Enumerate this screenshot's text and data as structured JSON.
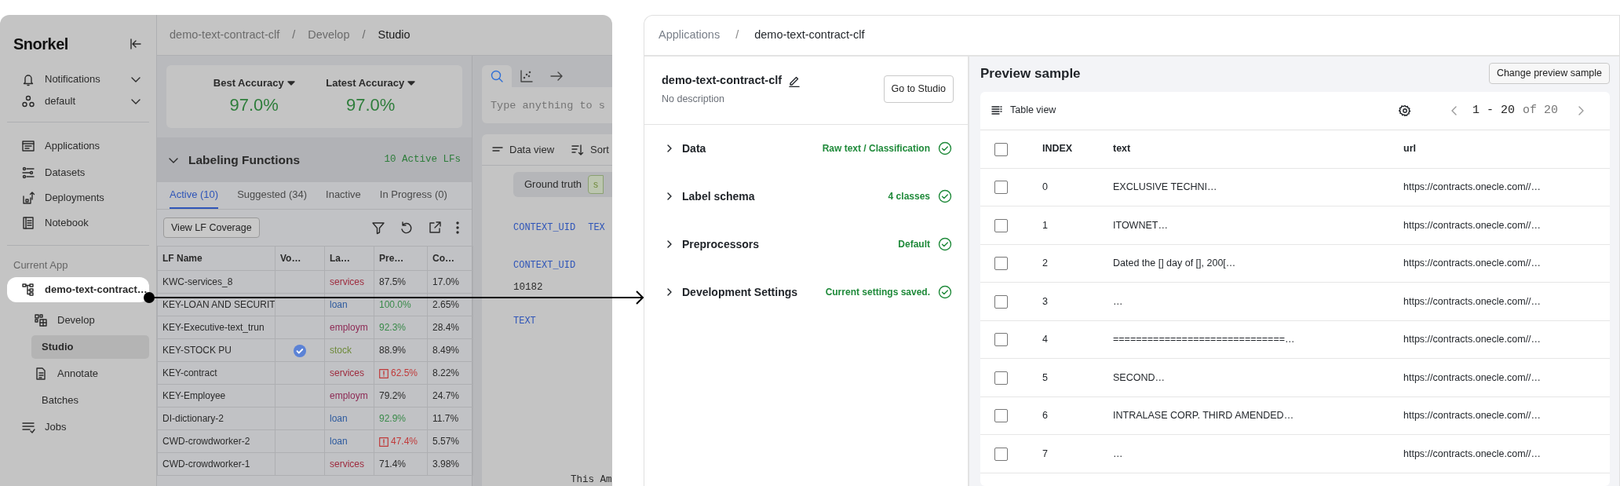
{
  "left_screen": {
    "sidebar": {
      "logo": "Snorkel",
      "menus": [
        {
          "label": "Notifications"
        },
        {
          "label": "default"
        }
      ],
      "nav": [
        {
          "label": "Applications"
        },
        {
          "label": "Datasets"
        },
        {
          "label": "Deployments"
        },
        {
          "label": "Notebook"
        }
      ],
      "section_label": "Current App",
      "tree": [
        {
          "label": "demo-text-contract…",
          "selected": true,
          "children": [
            {
              "label": "Develop",
              "selected": false,
              "children": [
                {
                  "label": "Studio",
                  "selected": true
                }
              ]
            },
            {
              "label": "Annotate",
              "selected": false,
              "children": [
                {
                  "label": "Batches",
                  "selected": false
                }
              ]
            }
          ]
        }
      ],
      "footer_nav": [
        {
          "label": "Jobs"
        }
      ]
    },
    "breadcrumb": {
      "separator": "/",
      "items": [
        "demo-text-contract-clf",
        "Develop",
        "Studio"
      ]
    },
    "accuracy": [
      {
        "label": "Best Accuracy",
        "value": "97.0%"
      },
      {
        "label": "Latest Accuracy",
        "value": "97.0%"
      }
    ],
    "lf_panel": {
      "title": "Labeling Functions",
      "expanded": true,
      "count": "10 Active LFs",
      "tabs": [
        {
          "label": "Active (10)",
          "selected": true
        },
        {
          "label": "Suggested (34)",
          "selected": false
        },
        {
          "label": "Inactive",
          "selected": false
        },
        {
          "label": "In Progress (0)",
          "selected": false
        }
      ],
      "coverage_button": "View LF Coverage",
      "columns": [
        "LF Name",
        "Vo…",
        "La…",
        "Pre…",
        "Co…"
      ],
      "rows": [
        {
          "name": "KWC-services_8",
          "checked": false,
          "label": "services",
          "color": "#9e2a3d",
          "precision": "87.5%",
          "kind": "normal",
          "coverage": "17.0%"
        },
        {
          "name": "KEY-LOAN AND SECURIT",
          "checked": false,
          "label": "loan",
          "color": "#2d5a9e",
          "precision": "100.0%",
          "kind": "high",
          "coverage": "2.65%"
        },
        {
          "name": "KEY-Executive-text_trun",
          "checked": false,
          "label": "employm",
          "color": "#8e2a55",
          "precision": "92.3%",
          "kind": "high",
          "coverage": "28.4%"
        },
        {
          "name": "KEY-STOCK PU",
          "checked": true,
          "label": "stock",
          "color": "#6e8a3a",
          "precision": "88.9%",
          "kind": "normal",
          "coverage": "8.49%"
        },
        {
          "name": "KEY-contract",
          "checked": false,
          "label": "services",
          "color": "#9e2a3d",
          "precision": "62.5%",
          "kind": "low",
          "coverage": "8.22%"
        },
        {
          "name": "KEY-Employee",
          "checked": false,
          "label": "employm",
          "color": "#8e2a55",
          "precision": "79.2%",
          "kind": "normal",
          "coverage": "24.7%"
        },
        {
          "name": "DI-dictionary-2",
          "checked": false,
          "label": "loan",
          "color": "#2d5a9e",
          "precision": "92.9%",
          "kind": "high",
          "coverage": "11.7%"
        },
        {
          "name": "CWD-crowdworker-2",
          "checked": false,
          "label": "loan",
          "color": "#2d5a9e",
          "precision": "47.4%",
          "kind": "low",
          "coverage": "5.57%"
        },
        {
          "name": "CWD-crowdworker-1",
          "checked": false,
          "label": "services",
          "color": "#9e2a3d",
          "precision": "71.4%",
          "kind": "normal",
          "coverage": "3.98%"
        }
      ]
    },
    "search": {
      "tabs": [
        {
          "selected": true
        },
        {
          "selected": false
        },
        {
          "selected": false
        }
      ],
      "placeholder": "Type anything to s"
    },
    "data_view": {
      "view_label": "Data view",
      "sort_label": "Sort",
      "ground_truth_label": "Ground truth",
      "ground_truth_value": "s",
      "header_fields": [
        "CONTEXT_UID",
        "TEX"
      ],
      "fields": [
        {
          "key": "CONTEXT_UID",
          "value": "10182"
        },
        {
          "key": "TEXT",
          "value": "This Am"
        }
      ]
    }
  },
  "right_screen": {
    "breadcrumb": {
      "separator": "/",
      "items": [
        "Applications",
        "demo-text-contract-clf"
      ]
    },
    "app": {
      "name": "demo-text-contract-clf",
      "description": "No description",
      "button": "Go to Studio"
    },
    "sections": [
      {
        "label": "Data",
        "status": "Raw text / Classification",
        "expanded": false
      },
      {
        "label": "Label schema",
        "status": "4 classes",
        "expanded": false
      },
      {
        "label": "Preprocessors",
        "status": "Default",
        "expanded": false
      },
      {
        "label": "Development Settings",
        "status": "Current settings saved.",
        "expanded": false
      }
    ],
    "preview": {
      "title": "Preview sample",
      "button": "Change preview sample",
      "view_label": "Table view",
      "pager_range": "1 - 20",
      "pager_total": "of 20",
      "header_checked": false,
      "columns": [
        "INDEX",
        "text",
        "url"
      ],
      "rows": [
        {
          "checked": false,
          "index": "0",
          "text": "EXCLUSIVE TECHNI…",
          "url": "https://contracts.onecle.com//…"
        },
        {
          "checked": false,
          "index": "1",
          "text": "ITOWNET…",
          "url": "https://contracts.onecle.com//…"
        },
        {
          "checked": false,
          "index": "2",
          "text": "Dated the [] day of [], 200[…",
          "url": "https://contracts.onecle.com//…"
        },
        {
          "checked": false,
          "index": "3",
          "text": "…",
          "url": "https://contracts.onecle.com//…"
        },
        {
          "checked": false,
          "index": "4",
          "text": "==============================…",
          "url": "https://contracts.onecle.com//…"
        },
        {
          "checked": false,
          "index": "5",
          "text": "SECOND…",
          "url": "https://contracts.onecle.com//…"
        },
        {
          "checked": false,
          "index": "6",
          "text": "INTRALASE CORP. THIRD AMENDED…",
          "url": "https://contracts.onecle.com//…"
        },
        {
          "checked": false,
          "index": "7",
          "text": "…",
          "url": "https://contracts.onecle.com//…"
        }
      ]
    }
  }
}
